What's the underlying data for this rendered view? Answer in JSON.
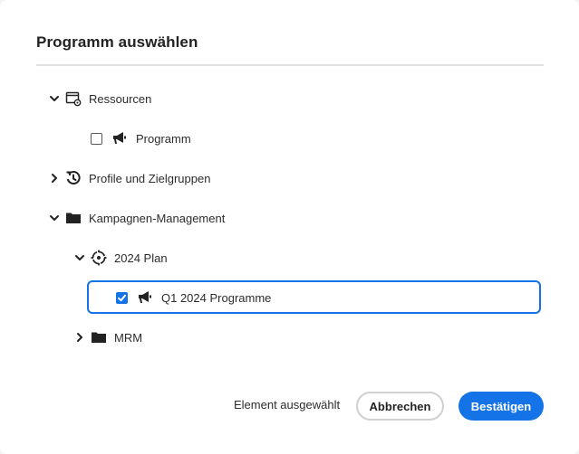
{
  "dialog": {
    "title": "Programm auswählen"
  },
  "tree": {
    "ressourcen": {
      "label": "Ressourcen",
      "expanded": true,
      "icon": "resources-settings-icon"
    },
    "programm": {
      "label": "Programm",
      "checked": false,
      "icon": "megaphone-icon"
    },
    "profile": {
      "label": "Profile und Zielgruppen",
      "expanded": false,
      "icon": "history-icon"
    },
    "kampagnen": {
      "label": "Kampagnen-Management",
      "expanded": true,
      "icon": "folder-icon"
    },
    "plan2024": {
      "label": "2024 Plan",
      "expanded": true,
      "icon": "target-plan-icon"
    },
    "q1": {
      "label": "Q1 2024 Programme",
      "checked": true,
      "icon": "megaphone-icon"
    },
    "mrm": {
      "label": "MRM",
      "expanded": false,
      "icon": "folder-icon"
    }
  },
  "footer": {
    "status": "Element ausgewählt",
    "cancel_label": "Abbrechen",
    "confirm_label": "Bestätigen"
  },
  "colors": {
    "accent": "#1473e6"
  }
}
